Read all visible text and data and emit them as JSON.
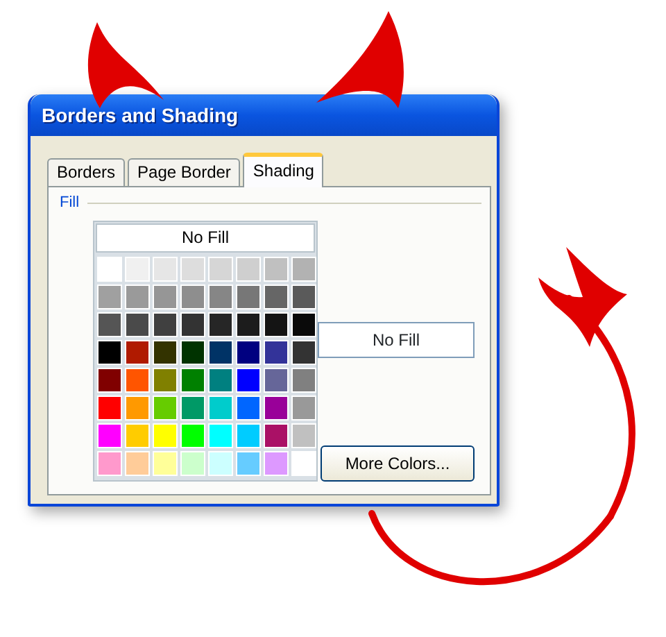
{
  "window": {
    "title": "Borders and Shading"
  },
  "tabs": [
    {
      "label": "Borders",
      "selected": false
    },
    {
      "label": "Page Border",
      "selected": false
    },
    {
      "label": "Shading",
      "selected": true
    }
  ],
  "fill": {
    "label": "Fill",
    "no_fill_option": "No Fill",
    "swatches": [
      {
        "color": "#ffffff"
      },
      {
        "color": "#f0f0f0"
      },
      {
        "color": "#e6e6e6"
      },
      {
        "color": "#dddddd"
      },
      {
        "color": "#d6d6d6"
      },
      {
        "color": "#cfcfcf"
      },
      {
        "color": "#c0c0c0"
      },
      {
        "color": "#b2b2b2"
      },
      {
        "color": "#a0a0a0"
      },
      {
        "color": "#9a9a9a"
      },
      {
        "color": "#969696"
      },
      {
        "color": "#8e8e8e"
      },
      {
        "color": "#868686"
      },
      {
        "color": "#777777"
      },
      {
        "color": "#666666"
      },
      {
        "color": "#5a5a5a"
      },
      {
        "color": "#555555"
      },
      {
        "color": "#4a4a4a"
      },
      {
        "color": "#404040"
      },
      {
        "color": "#333333"
      },
      {
        "color": "#262626"
      },
      {
        "color": "#1c1c1c"
      },
      {
        "color": "#141414"
      },
      {
        "color": "#0a0a0a"
      },
      {
        "color": "#000000"
      },
      {
        "color": "#b01a00"
      },
      {
        "color": "#333300"
      },
      {
        "color": "#003300"
      },
      {
        "color": "#003366"
      },
      {
        "color": "#000080"
      },
      {
        "color": "#333399"
      },
      {
        "color": "#333333"
      },
      {
        "color": "#800000"
      },
      {
        "color": "#ff5500"
      },
      {
        "color": "#808000"
      },
      {
        "color": "#008000"
      },
      {
        "color": "#008080"
      },
      {
        "color": "#0000ff"
      },
      {
        "color": "#666699"
      },
      {
        "color": "#808080"
      },
      {
        "color": "#ff0000"
      },
      {
        "color": "#ff9900"
      },
      {
        "color": "#66cc00"
      },
      {
        "color": "#009966"
      },
      {
        "color": "#00cccc"
      },
      {
        "color": "#0066ff"
      },
      {
        "color": "#990099"
      },
      {
        "color": "#999999"
      },
      {
        "color": "#ff00ff"
      },
      {
        "color": "#ffcc00"
      },
      {
        "color": "#ffff00"
      },
      {
        "color": "#00ff00"
      },
      {
        "color": "#00ffff"
      },
      {
        "color": "#00ccff"
      },
      {
        "color": "#aa1166"
      },
      {
        "color": "#c0c0c0"
      },
      {
        "color": "#ff99cc"
      },
      {
        "color": "#ffcc99"
      },
      {
        "color": "#ffff99"
      },
      {
        "color": "#ccffcc"
      },
      {
        "color": "#ccffff"
      },
      {
        "color": "#66ccff"
      },
      {
        "color": "#dd99ff"
      },
      {
        "color": "#ffffff"
      }
    ],
    "current": "No Fill",
    "more_button": "More Colors..."
  }
}
